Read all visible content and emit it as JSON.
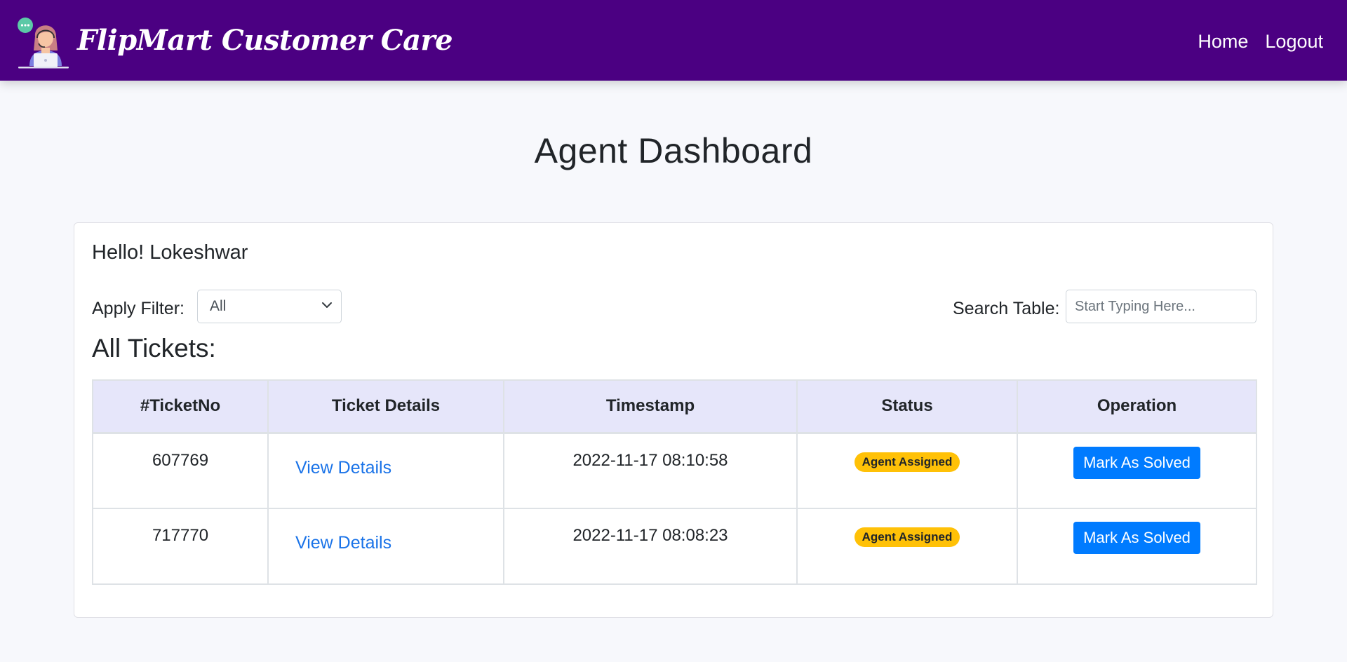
{
  "navbar": {
    "brand": "FlipMart Customer Care",
    "links": [
      "Home",
      "Logout"
    ],
    "color": "#4b0082"
  },
  "page": {
    "title": "Agent Dashboard"
  },
  "card": {
    "greeting": "Hello! Lokeshwar",
    "filter": {
      "label": "Apply Filter:",
      "selected": "All"
    },
    "search": {
      "label": "Search Table:",
      "placeholder": "Start Typing Here...",
      "value": ""
    },
    "section_title": "All Tickets:"
  },
  "table": {
    "headers": [
      "#TicketNo",
      "Ticket Details",
      "Timestamp",
      "Status",
      "Operation"
    ],
    "rows": [
      {
        "ticket_no": "607769",
        "details_link": "View Details",
        "timestamp": "2022-11-17 08:10:58",
        "status": "Agent Assigned",
        "operation": "Mark As Solved"
      },
      {
        "ticket_no": "717770",
        "details_link": "View Details",
        "timestamp": "2022-11-17 08:08:23",
        "status": "Agent Assigned",
        "operation": "Mark As Solved"
      }
    ]
  },
  "colors": {
    "accent": "#4b0082",
    "header_row": "#e6e6fa",
    "link": "#1a73e8",
    "badge_warning": "#ffc107",
    "button_primary": "#007bff"
  },
  "icons": {
    "brand": "customer-support-agent-icon",
    "select": "chevron-down-icon"
  }
}
